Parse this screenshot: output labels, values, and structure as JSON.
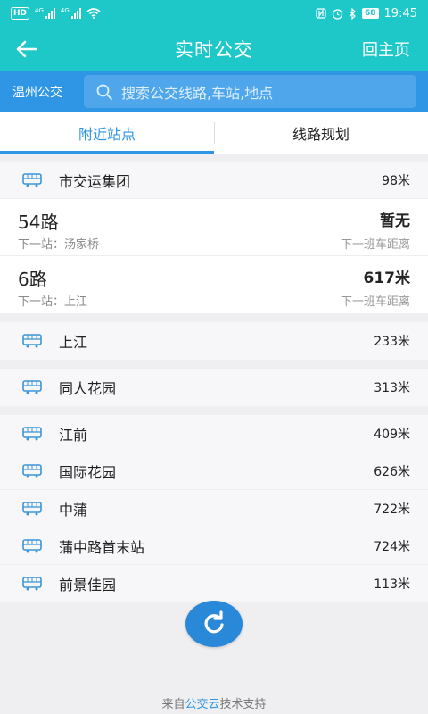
{
  "status_bar": {
    "hd_label": "HD",
    "signal1_label": "4G",
    "signal2_label": "4G",
    "battery": "68",
    "time": "19:45"
  },
  "app_bar": {
    "title": "实时公交",
    "home_label": "回主页"
  },
  "search_bar": {
    "city": "温州公交",
    "placeholder": "搜索公交线路,车站,地点"
  },
  "tabs": [
    {
      "label": "附近站点",
      "active": true
    },
    {
      "label": "线路规划",
      "active": false
    }
  ],
  "groups": [
    {
      "stop": {
        "name": "市交运集团",
        "distance": "98米"
      },
      "lines": [
        {
          "name": "54路",
          "next_stop": "下一站：汤家桥",
          "distance": "暂无",
          "caption": "下一班车距离"
        },
        {
          "name": "6路",
          "next_stop": "下一站：上江",
          "distance": "617米",
          "caption": "下一班车距离"
        }
      ]
    },
    {
      "stops": [
        {
          "name": "上江",
          "distance": "233米"
        }
      ]
    },
    {
      "stops": [
        {
          "name": "同人花园",
          "distance": "313米"
        }
      ]
    },
    {
      "stops": [
        {
          "name": "江前",
          "distance": "409米"
        },
        {
          "name": "国际花园",
          "distance": "626米"
        },
        {
          "name": "中蒲",
          "distance": "722米"
        },
        {
          "name": "蒲中路首末站",
          "distance": "724米"
        },
        {
          "name": "前景佳园",
          "distance": "113米"
        }
      ]
    }
  ],
  "footer": {
    "prefix": "来自",
    "brand": "公交云",
    "suffix": "技术支持"
  },
  "colors": {
    "header": "#1ec8c8",
    "search_bar": "#2f96e6",
    "accent": "#2f96e6",
    "refresh_button": "#2a88d8"
  }
}
